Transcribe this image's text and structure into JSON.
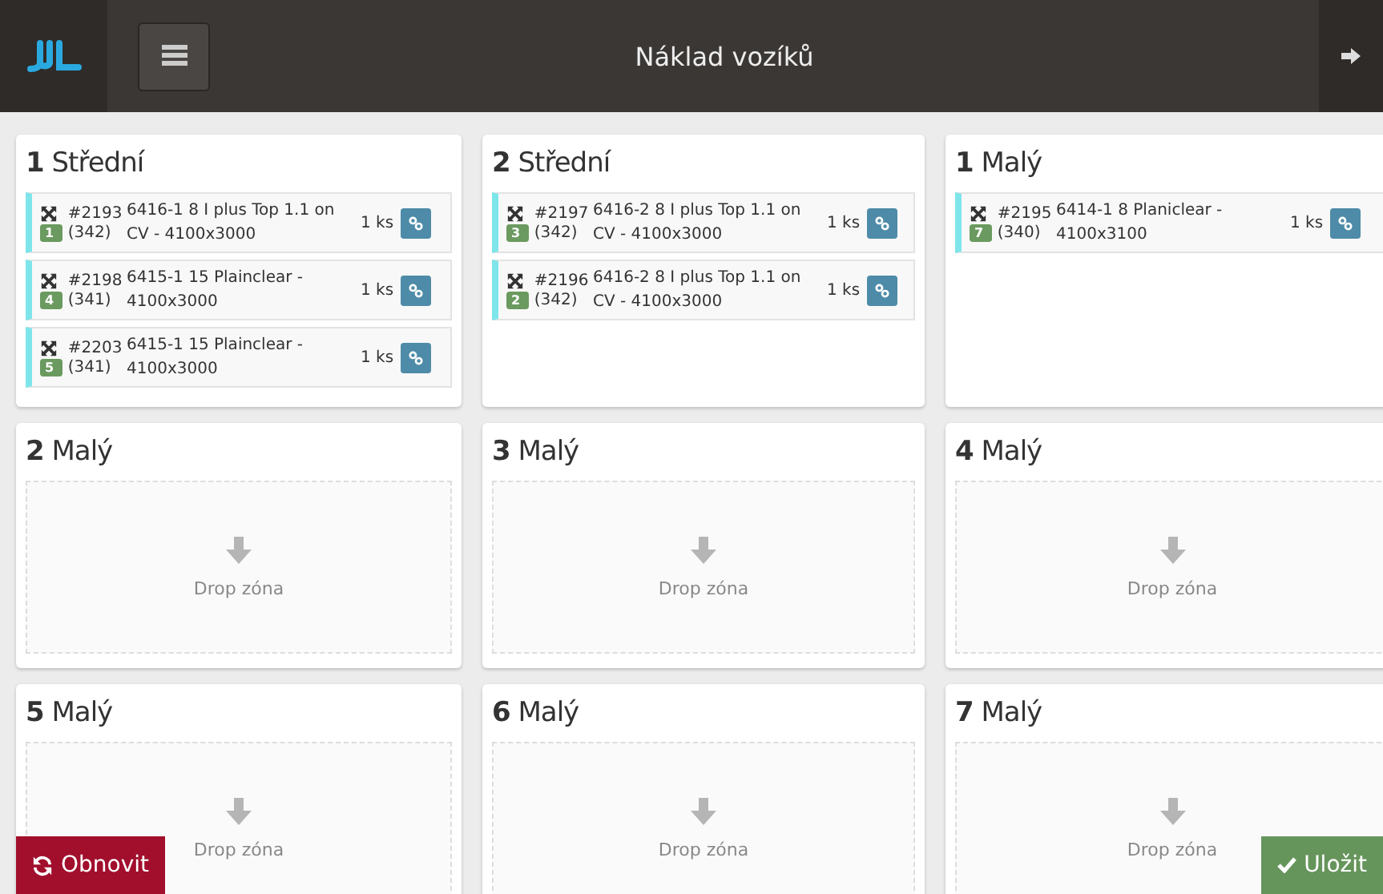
{
  "header": {
    "title": "Náklad vozíků"
  },
  "carts": [
    {
      "number": "1",
      "size": "Střední",
      "items": [
        {
          "id": "#2193",
          "code": "(342)",
          "name": "6416-1 8 I plus Top 1.1 on CV - 4100x3000",
          "badge": "1",
          "qty": "1 ks"
        },
        {
          "id": "#2198",
          "code": "(341)",
          "name": "6415-1 15 Plainclear - 4100x3000",
          "badge": "4",
          "qty": "1 ks"
        },
        {
          "id": "#2203",
          "code": "(341)",
          "name": "6415-1 15 Plainclear - 4100x3000",
          "badge": "5",
          "qty": "1 ks"
        }
      ]
    },
    {
      "number": "2",
      "size": "Střední",
      "items": [
        {
          "id": "#2197",
          "code": "(342)",
          "name": "6416-2 8 I plus Top 1.1 on CV - 4100x3000",
          "badge": "3",
          "qty": "1 ks"
        },
        {
          "id": "#2196",
          "code": "(342)",
          "name": "6416-2 8 I plus Top 1.1 on CV - 4100x3000",
          "badge": "2",
          "qty": "1 ks"
        }
      ]
    },
    {
      "number": "1",
      "size": "Malý",
      "items": [
        {
          "id": "#2195",
          "code": "(340)",
          "name": "6414-1 8 Planiclear - 4100x3100",
          "badge": "7",
          "qty": "1 ks"
        }
      ]
    },
    {
      "number": "2",
      "size": "Malý",
      "drop_zone": "Drop zóna"
    },
    {
      "number": "3",
      "size": "Malý",
      "drop_zone": "Drop zóna"
    },
    {
      "number": "4",
      "size": "Malý",
      "drop_zone": "Drop zóna"
    },
    {
      "number": "5",
      "size": "Malý",
      "drop_zone": "Drop zóna"
    },
    {
      "number": "6",
      "size": "Malý",
      "drop_zone": "Drop zóna"
    },
    {
      "number": "7",
      "size": "Malý",
      "drop_zone": "Drop zóna"
    }
  ],
  "buttons": [
    {
      "kind": "refresh",
      "label": "Obnovit"
    },
    {
      "kind": "save",
      "label": "Uložit"
    }
  ]
}
